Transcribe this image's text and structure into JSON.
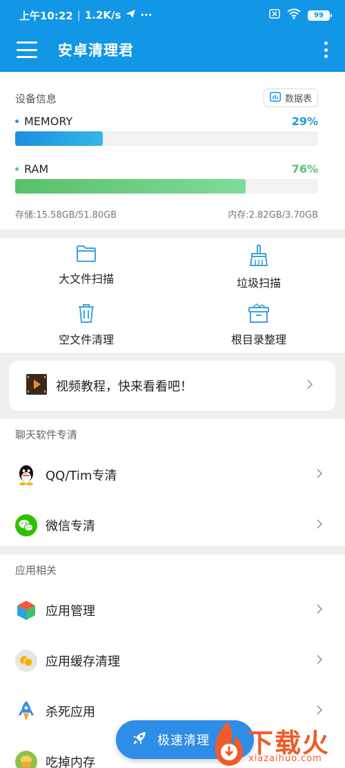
{
  "status_bar": {
    "time": "上午10:22",
    "speed": "1.2K/s",
    "extra": "···",
    "battery": "99"
  },
  "header": {
    "title": "安卓清理君"
  },
  "device_info": {
    "title": "设备信息",
    "data_table_label": "数据表",
    "memory": {
      "label": "MEMORY",
      "percent_text": "29%",
      "percent": 29,
      "color": "#1e9be0"
    },
    "ram": {
      "label": "RAM",
      "percent_text": "76%",
      "percent": 76,
      "color": "#5cc46e"
    },
    "storage": "存储:15.58GB/51.80GB",
    "memory_usage": "内存:2.82GB/3.70GB"
  },
  "tools": [
    {
      "label": "大文件扫描",
      "icon": "folder-icon"
    },
    {
      "label": "垃圾扫描",
      "icon": "broom-icon"
    },
    {
      "label": "空文件清理",
      "icon": "trash-icon"
    },
    {
      "label": "根目录整理",
      "icon": "box-icon"
    }
  ],
  "video_banner": {
    "label": "视频教程，快来看看吧！",
    "icon": "video-icon"
  },
  "chat_section": {
    "title": "聊天软件专清",
    "items": [
      {
        "label": "QQ/Tim专清",
        "icon": "qq-icon"
      },
      {
        "label": "微信专清",
        "icon": "wechat-icon"
      }
    ]
  },
  "app_section": {
    "title": "应用相关",
    "items": [
      {
        "label": "应用管理",
        "icon": "cube-icon"
      },
      {
        "label": "应用缓存清理",
        "icon": "cache-icon"
      },
      {
        "label": "杀死应用",
        "icon": "rocket-icon"
      },
      {
        "label": "吃掉内存",
        "icon": "food-icon"
      }
    ]
  },
  "fab": {
    "label": "极速清理"
  },
  "watermark": {
    "text": "下载火",
    "sub": "xiazaihuo.com"
  },
  "colors": {
    "primary": "#1296e6",
    "memory": "#1e9be0",
    "ram": "#5cc46e",
    "fab": "#2e8de6"
  }
}
